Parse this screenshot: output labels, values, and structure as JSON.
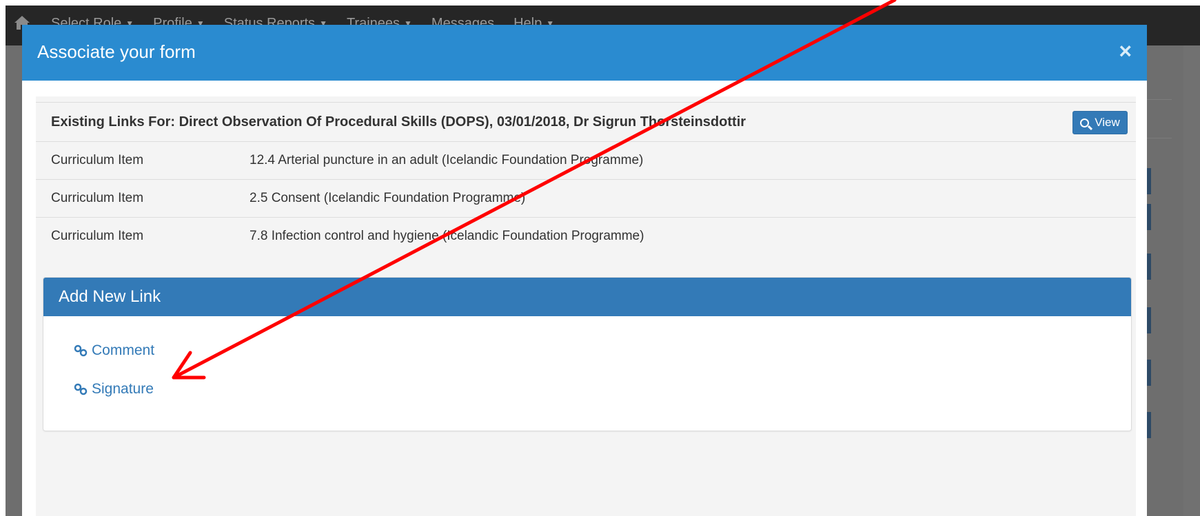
{
  "nav": {
    "home_icon": "home-icon",
    "items": [
      {
        "label": "Select Role",
        "has_caret": true
      },
      {
        "label": "Profile",
        "has_caret": true
      },
      {
        "label": "Status Reports",
        "has_caret": true
      },
      {
        "label": "Trainees",
        "has_caret": true
      },
      {
        "label": "Messages",
        "has_caret": false
      },
      {
        "label": "Help",
        "has_caret": true
      }
    ]
  },
  "modal": {
    "title": "Associate your form",
    "close_label": "×",
    "existing_links": {
      "header": "Existing Links For: Direct Observation Of Procedural Skills (DOPS), 03/01/2018, Dr Sigrun Thorsteinsdottir",
      "view_label": "View",
      "view_icon": "search-icon",
      "rows": [
        {
          "type": "Curriculum Item",
          "value": "12.4 Arterial puncture in an adult (Icelandic Foundation Programme)"
        },
        {
          "type": "Curriculum Item",
          "value": "2.5 Consent (Icelandic Foundation Programme)"
        },
        {
          "type": "Curriculum Item",
          "value": "7.8 Infection control and hygiene (Icelandic Foundation Programme)"
        }
      ]
    },
    "add_new_link": {
      "title": "Add New Link",
      "links": [
        {
          "label": "Comment",
          "icon": "link-icon"
        },
        {
          "label": "Signature",
          "icon": "link-icon"
        }
      ]
    }
  },
  "colors": {
    "modal_header": "#2a8bd0",
    "panel_header": "#337ab7",
    "link": "#337ab7",
    "annotation_arrow": "#ff0000"
  }
}
